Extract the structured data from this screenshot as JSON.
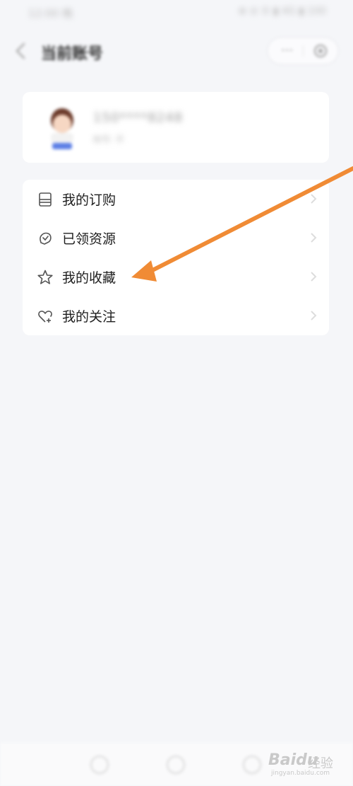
{
  "status_bar": {
    "time": "12:00 晚",
    "indicators": "⊕ ⊘ ⑤ ▮ 4G ▮ 100"
  },
  "header": {
    "title": "当前账号",
    "back_icon": "chevron-left-icon",
    "more_icon": "more-icon",
    "more_glyph": "···",
    "target_icon": "target-icon"
  },
  "profile": {
    "username": "150****8248",
    "subtitle": "帐号: 手",
    "avatar_icon": "avatar-icon"
  },
  "menu": {
    "items": [
      {
        "label": "我的订购",
        "icon": "order-icon"
      },
      {
        "label": "已领资源",
        "icon": "resource-icon"
      },
      {
        "label": "我的收藏",
        "icon": "star-icon"
      },
      {
        "label": "我的关注",
        "icon": "heart-plus-icon"
      }
    ]
  },
  "watermark": {
    "logo": "Baidu",
    "text": "经验",
    "url": "jingyan.baidu.com"
  },
  "colors": {
    "background": "#f5f6f9",
    "card": "#ffffff",
    "arrow": "#f08b35",
    "text": "#1e1e1e"
  }
}
